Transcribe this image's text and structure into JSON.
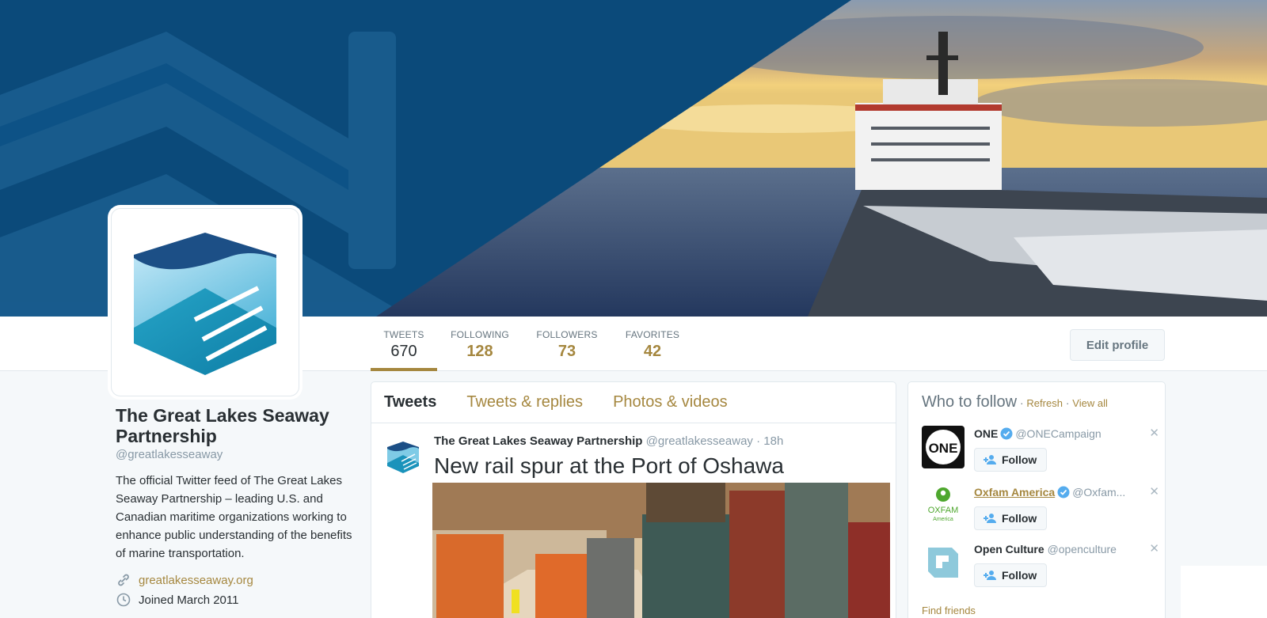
{
  "profile": {
    "name": "The Great Lakes Seaway Partnership",
    "handle": "@greatlakesseaway",
    "bio": "The official Twitter feed of The Great Lakes Seaway Partnership – leading U.S. and Canadian maritime organizations working to enhance public understanding of the benefits of marine transportation.",
    "website": "greatlakesseaway.org",
    "joined": "Joined March 2011",
    "link_icon": "link-icon",
    "calendar_icon": "clock-icon"
  },
  "stats": [
    {
      "label": "TWEETS",
      "value": "670"
    },
    {
      "label": "FOLLOWING",
      "value": "128"
    },
    {
      "label": "FOLLOWERS",
      "value": "73"
    },
    {
      "label": "FAVORITES",
      "value": "42"
    }
  ],
  "edit_profile_label": "Edit profile",
  "timeline": {
    "tabs": [
      "Tweets",
      "Tweets & replies",
      "Photos & videos"
    ],
    "tweet": {
      "author": "The Great Lakes Seaway Partnership",
      "handle": "@greatlakesseaway",
      "time": "· 18h",
      "text": "New rail spur at the Port of Oshawa"
    }
  },
  "who_to_follow": {
    "title": "Who to follow",
    "refresh": "Refresh",
    "view_all": "View all",
    "separator": "·",
    "follow_label": "Follow",
    "find_friends": "Find friends",
    "users": [
      {
        "name": "ONE",
        "handle": "@ONECampaign",
        "verified": true,
        "avatar_text": "ONE"
      },
      {
        "name": "Oxfam America",
        "handle": "@Oxfam...",
        "verified": true,
        "avatar_text": "OXFAM",
        "avatar_sub": "America"
      },
      {
        "name": "Open Culture",
        "handle": "@openculture",
        "verified": false
      }
    ]
  },
  "colors": {
    "accent": "#a5873f",
    "banner_blue": "#0b4a7a",
    "verified": "#55acee"
  }
}
